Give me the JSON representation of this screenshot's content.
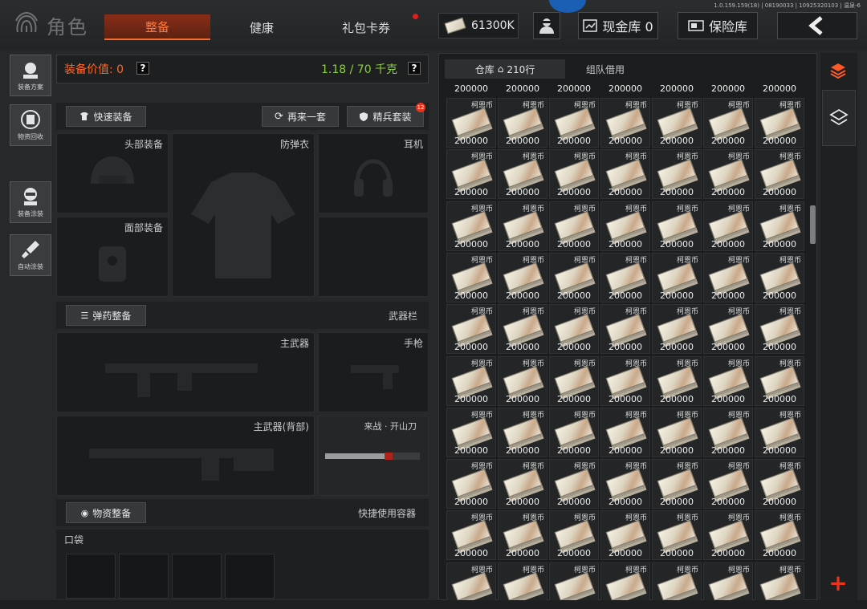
{
  "version": "1.0.159.159(18) | 08190033 | 10925320103 | 温泉-6",
  "header": {
    "title": "角色",
    "tabs": [
      {
        "label": "整备",
        "active": true
      },
      {
        "label": "健康",
        "active": false
      },
      {
        "label": "礼包卡券",
        "active": false
      }
    ],
    "money": "61300K",
    "cash_vault": "现金库 0",
    "safe_vault": "保险库",
    "accent_color": "#ff6a2a"
  },
  "left_rail": [
    {
      "label": "装备方案",
      "icon": "gear-preset-icon"
    },
    {
      "label": "物资回收",
      "icon": "recycle-icon"
    },
    {
      "label": "装备涂装",
      "icon": "skin-icon"
    },
    {
      "label": "自动涂装",
      "icon": "brush-icon"
    }
  ],
  "equipment": {
    "value_label": "装备价值: 0",
    "weight": "1.18 / 70 千克",
    "help": "?",
    "quick_equip": "快速装备",
    "again": "再来一套",
    "elite": "精兵套装",
    "elite_badge": "12",
    "slots": {
      "head": "头部装备",
      "armor": "防弹衣",
      "ear": "耳机",
      "face": "面部装备"
    },
    "ammo_btn": "弹药整备",
    "weapon_bar": "武器栏",
    "primary": "主武器",
    "pistol": "手枪",
    "primary_back": "主武器(背部)",
    "melee": "来战 · 开山刀",
    "supply_btn": "物资整备",
    "quick_container": "快捷使用容器",
    "pocket": "口袋"
  },
  "storage": {
    "tab_storage": "仓库",
    "rows": "210行",
    "tab_team": "组队借用",
    "item_name": "柯恩币",
    "item_qty": "200000",
    "columns": 7,
    "visible_rows": 10
  }
}
